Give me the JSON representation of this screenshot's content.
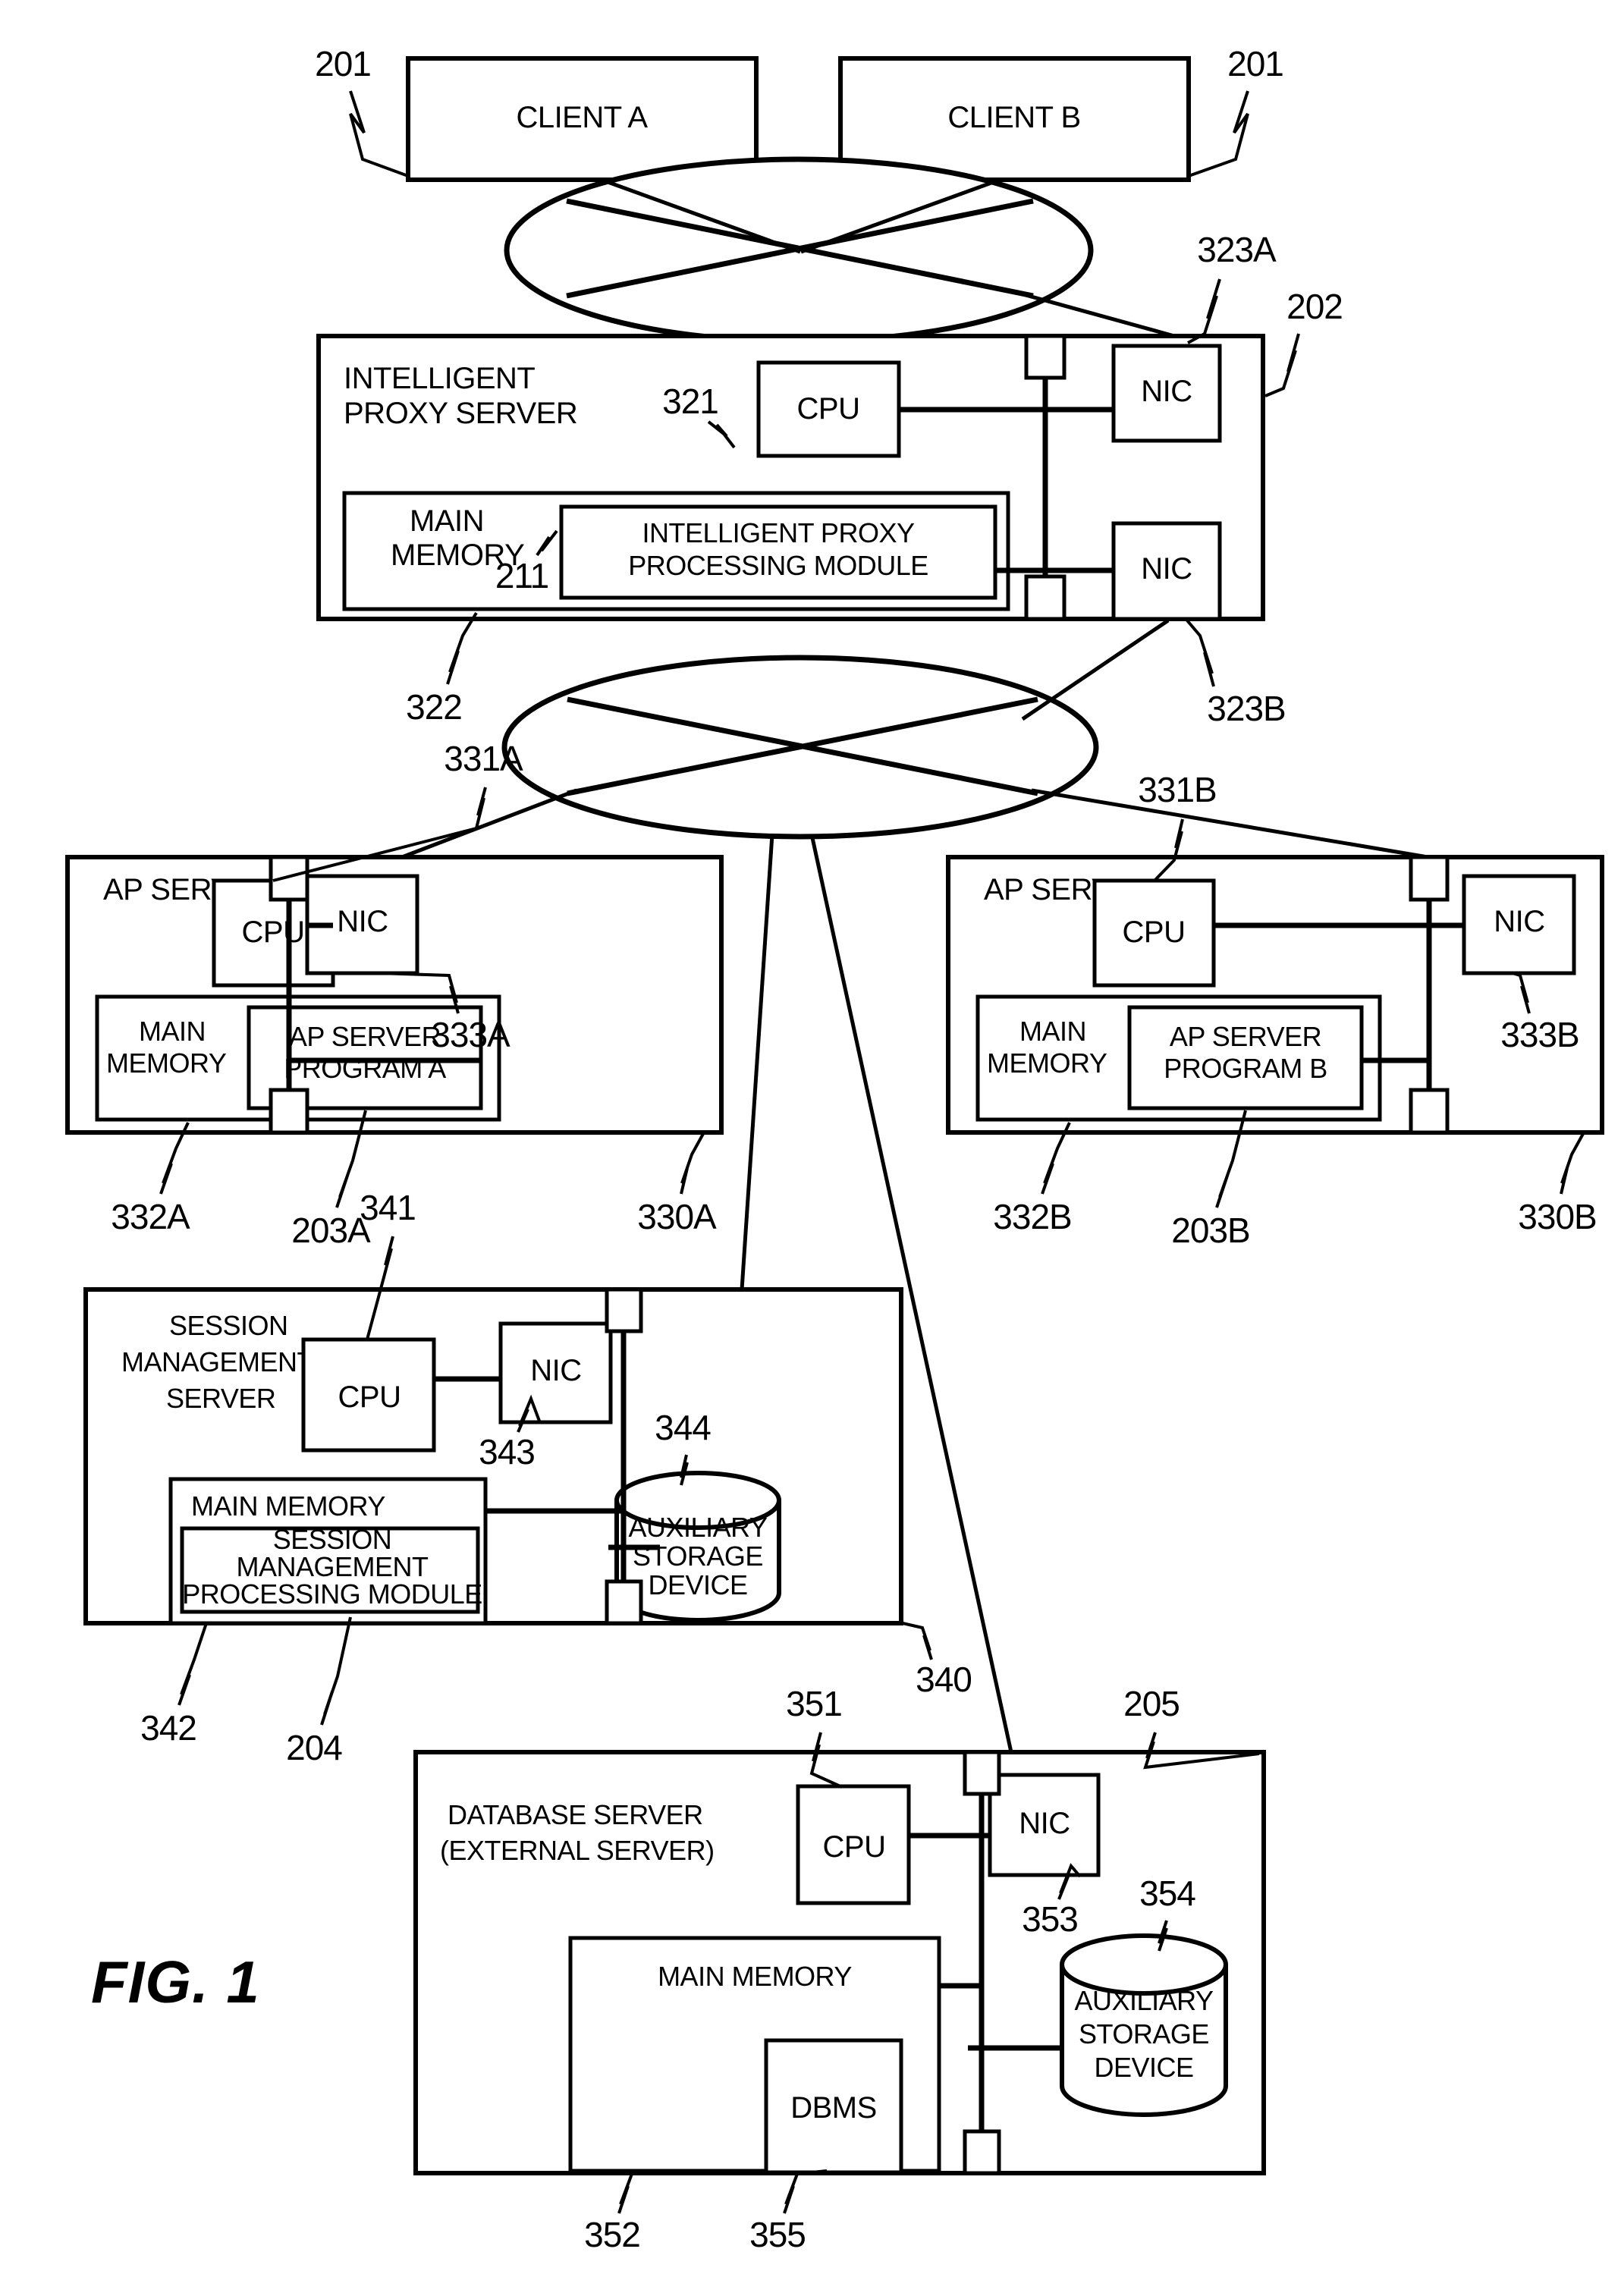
{
  "figure": {
    "title": "FIG. 1",
    "caption_position": "bottom-left"
  },
  "clients": [
    {
      "label": "CLIENT A",
      "ref": "201"
    },
    {
      "label": "CLIENT B",
      "ref": "201"
    }
  ],
  "networks": [
    {
      "name": "upper-network",
      "icon": "network-cloud-icon"
    },
    {
      "name": "lower-network",
      "icon": "network-cloud-icon"
    }
  ],
  "proxy_server": {
    "title_line1": "INTELLIGENT",
    "title_line2": "PROXY SERVER",
    "ref": "202",
    "cpu": {
      "label": "CPU",
      "ref": "321"
    },
    "memory": {
      "label_line1": "MAIN",
      "label_line2": "MEMORY",
      "ref": "322"
    },
    "module": {
      "label_line1": "INTELLIGENT PROXY",
      "label_line2": "PROCESSING MODULE",
      "ref": "211"
    },
    "nic_top": {
      "label": "NIC",
      "ref": "323A"
    },
    "nic_bottom": {
      "label": "NIC",
      "ref": "323B"
    }
  },
  "ap_server_a": {
    "title": "AP SERVER A",
    "ref": "330A",
    "cpu": {
      "label": "CPU",
      "ref": "331A"
    },
    "memory": {
      "label_line1": "MAIN",
      "label_line2": "MEMORY",
      "ref": "332A"
    },
    "program": {
      "label_line1": "AP SERVER",
      "label_line2": "PROGRAM A",
      "ref": "203A"
    },
    "nic": {
      "label": "NIC",
      "ref": "333A"
    }
  },
  "ap_server_b": {
    "title": "AP SERVER B",
    "ref": "330B",
    "cpu": {
      "label": "CPU",
      "ref": "331B"
    },
    "memory": {
      "label_line1": "MAIN",
      "label_line2": "MEMORY",
      "ref": "332B"
    },
    "program": {
      "label_line1": "AP SERVER",
      "label_line2": "PROGRAM B",
      "ref": "203B"
    },
    "nic": {
      "label": "NIC",
      "ref": "333B"
    }
  },
  "session_server": {
    "title_line1": "SESSION",
    "title_line2": "MANAGEMENT",
    "title_line3": "SERVER",
    "ref": "340",
    "cpu": {
      "label": "CPU",
      "ref": "341"
    },
    "memory": {
      "label": "MAIN MEMORY",
      "ref": "342"
    },
    "module": {
      "label_line1": "SESSION",
      "label_line2": "MANAGEMENT",
      "label_line3": "PROCESSING MODULE",
      "ref": "204"
    },
    "nic": {
      "label": "NIC",
      "ref": "343"
    },
    "storage": {
      "label_line1": "AUXILIARY",
      "label_line2": "STORAGE",
      "label_line3": "DEVICE",
      "ref": "344"
    }
  },
  "database_server": {
    "title_line1": "DATABASE SERVER",
    "title_line2": "(EXTERNAL SERVER)",
    "ref": "205",
    "cpu": {
      "label": "CPU",
      "ref": "351"
    },
    "memory": {
      "label": "MAIN MEMORY",
      "ref": "352"
    },
    "dbms": {
      "label": "DBMS",
      "ref": "355"
    },
    "nic": {
      "label": "NIC",
      "ref": "353"
    },
    "storage": {
      "label_line1": "AUXILIARY",
      "label_line2": "STORAGE",
      "label_line3": "DEVICE",
      "ref": "354"
    }
  },
  "colors": {
    "ink": "#000000",
    "paper": "#ffffff"
  }
}
